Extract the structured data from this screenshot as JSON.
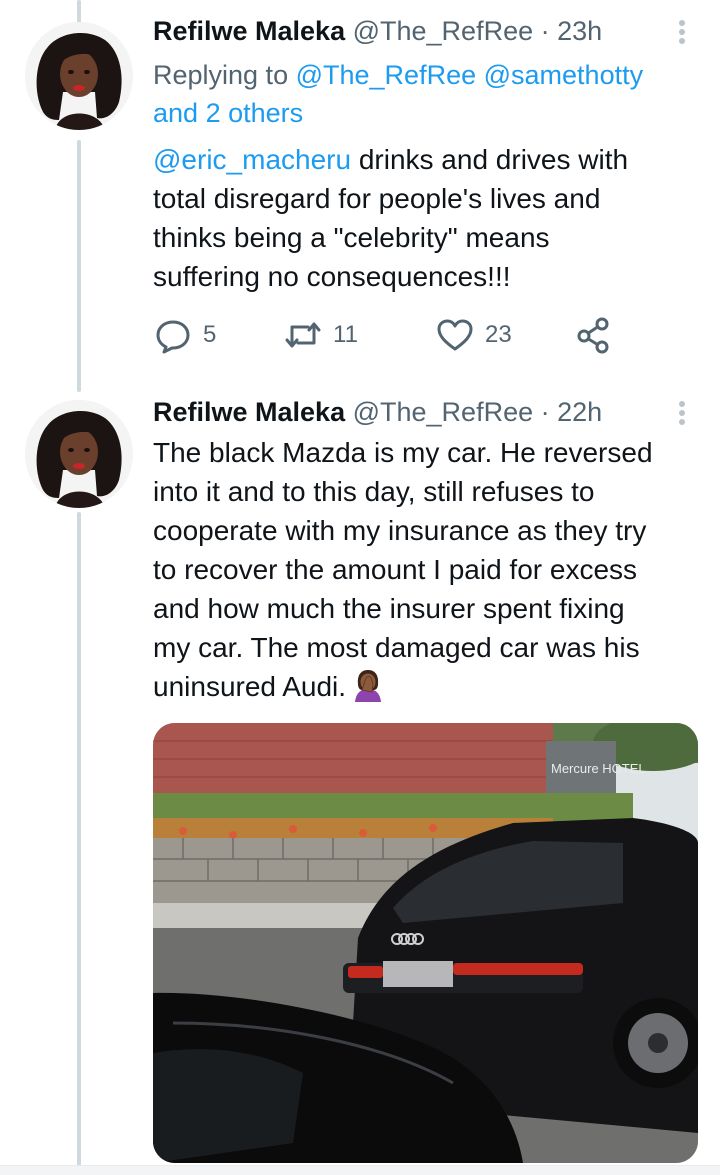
{
  "tweets": [
    {
      "author_name": "Refilwe Maleka",
      "handle": "@The_RefRee",
      "separator": "·",
      "time": "23h",
      "reply_prefix": "Replying to",
      "reply_handles": [
        "@The_RefRee",
        "@samethotty"
      ],
      "reply_and": "and",
      "reply_others": "2 others",
      "mention": "@eric_macheru",
      "text_lines": [
        " drinks and drives with",
        "total disregard for people's lives and",
        "thinks being a \"celebrity\" means",
        "suffering no consequences!!!"
      ],
      "replies": "5",
      "retweets": "11",
      "likes": "23"
    },
    {
      "author_name": "Refilwe Maleka",
      "handle": "@The_RefRee",
      "separator": "·",
      "time": "22h",
      "text_lines": [
        "The black Mazda is my car. He reversed",
        "into it and to this day, still refuses to",
        "cooperate with my insurance as they try",
        "to recover the amount I paid for excess",
        "and how much the insurer spent fixing",
        "my car. The most damaged car was his",
        "uninsured Audi."
      ],
      "emoji": "woman-facepalming-emoji",
      "media_sign_text": "Mercure HOTEL"
    }
  ],
  "icons": {
    "reply": "reply-icon",
    "retweet": "retweet-icon",
    "like": "heart-icon",
    "share": "share-icon",
    "more": "more-vertical-icon"
  },
  "colors": {
    "link": "#1d9bf0",
    "secondary_text": "#536471",
    "thread_line": "#cfd9de"
  }
}
